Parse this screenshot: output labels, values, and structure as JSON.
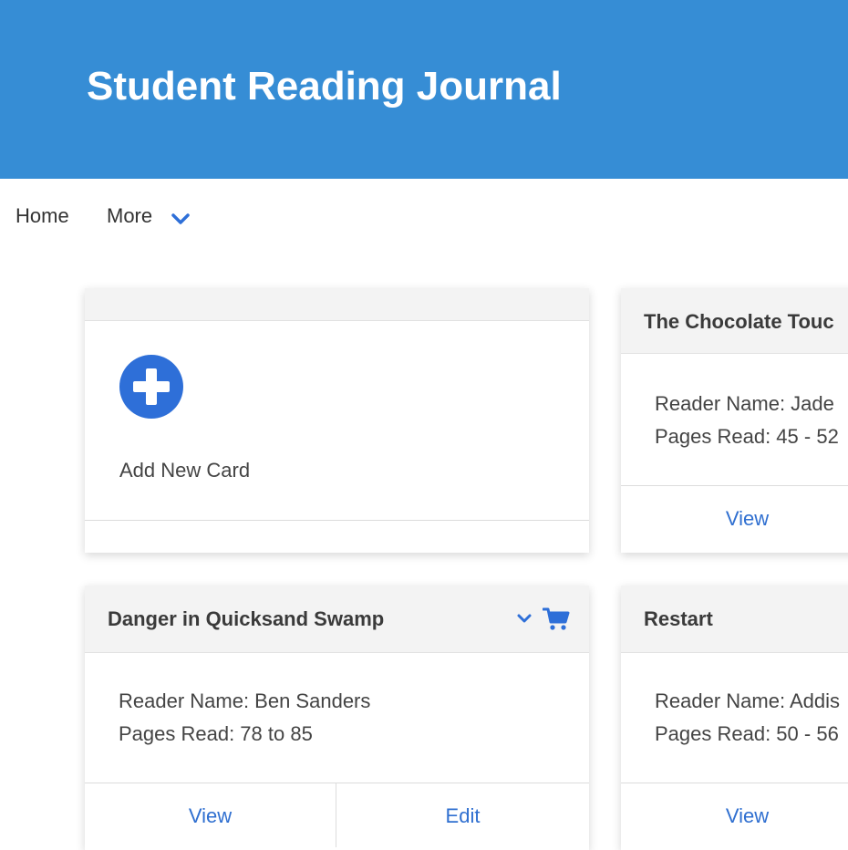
{
  "header": {
    "title": "Student Reading Journal"
  },
  "nav": {
    "home_label": "Home",
    "more_label": "More",
    "more_icon": "chevron-down-icon"
  },
  "colors": {
    "header_bg": "#368dd5",
    "accent": "#2e6fd8",
    "link": "#2f6fd0",
    "card_header_bg": "#f3f3f3"
  },
  "add_card": {
    "label": "Add New Card",
    "icon": "plus-circle-icon"
  },
  "cards": [
    {
      "title": "The Chocolate Touc",
      "reader_line": "Reader Name: Jade",
      "pages_line": "Pages Read: 45 - 52",
      "view_label": "View"
    },
    {
      "title": "Danger in Quicksand Swamp",
      "reader_line": "Reader Name: Ben Sanders",
      "pages_line": "Pages Read: 78 to 85",
      "view_label": "View",
      "edit_label": "Edit",
      "icons": [
        "chevron-down-icon",
        "cart-icon"
      ]
    },
    {
      "title": "Restart",
      "reader_line": "Reader Name: Addis",
      "pages_line": "Pages Read: 50 - 56",
      "view_label": "View"
    }
  ]
}
